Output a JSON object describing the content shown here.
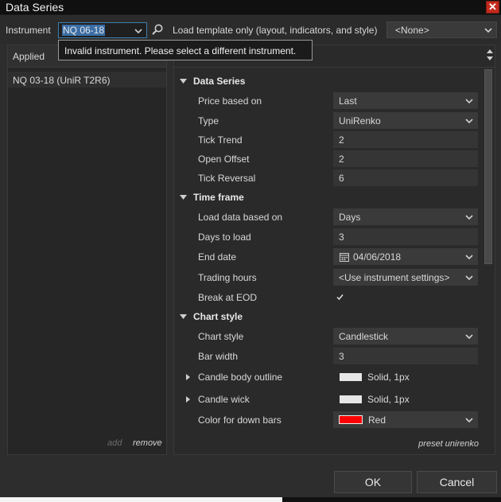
{
  "window": {
    "title": "Data Series",
    "close_glyph": "✕"
  },
  "toolbar": {
    "instrument_label": "Instrument",
    "instrument_value": "NQ 06-18",
    "template_label": "Load template only (layout, indicators, and style)",
    "template_value": "<None>"
  },
  "tooltip": {
    "text": "Invalid instrument. Please select a different instrument."
  },
  "applied": {
    "header": "Applied",
    "items": [
      "NQ 03-18 (UniR T2R6)"
    ],
    "add_label": "add",
    "remove_label": "remove"
  },
  "properties": {
    "sections": [
      {
        "title": "Data Series",
        "rows": [
          {
            "label": "Price based on",
            "value": "Last",
            "kind": "select"
          },
          {
            "label": "Type",
            "value": "UniRenko",
            "kind": "select"
          },
          {
            "label": "Tick Trend",
            "value": "2",
            "kind": "input"
          },
          {
            "label": "Open Offset",
            "value": "2",
            "kind": "input"
          },
          {
            "label": "Tick Reversal",
            "value": "6",
            "kind": "input"
          }
        ]
      },
      {
        "title": "Time frame",
        "rows": [
          {
            "label": "Load data based on",
            "value": "Days",
            "kind": "select"
          },
          {
            "label": "Days to load",
            "value": "3",
            "kind": "input"
          },
          {
            "label": "End date",
            "value": "04/06/2018",
            "kind": "date"
          },
          {
            "label": "Trading hours",
            "value": "<Use instrument settings>",
            "kind": "select"
          },
          {
            "label": "Break at EOD",
            "value": "checked",
            "kind": "checkbox"
          }
        ]
      },
      {
        "title": "Chart style",
        "rows": [
          {
            "label": "Chart style",
            "value": "Candlestick",
            "kind": "select"
          },
          {
            "label": "Bar width",
            "value": "3",
            "kind": "input"
          },
          {
            "label": "Candle body outline",
            "value": "Solid, 1px",
            "kind": "stroke",
            "color": "#e6e6e6"
          },
          {
            "label": "Candle wick",
            "value": "Solid, 1px",
            "kind": "stroke",
            "color": "#e6e6e6"
          },
          {
            "label": "Color for down bars",
            "value": "Red",
            "kind": "color",
            "color": "#ff0000"
          }
        ]
      }
    ],
    "preset_label": "preset unirenko"
  },
  "buttons": {
    "ok": "OK",
    "cancel": "Cancel"
  },
  "colors": {
    "accent": "#3b6ea5",
    "close": "#c42b1c",
    "down_bar": "#ff0000"
  }
}
